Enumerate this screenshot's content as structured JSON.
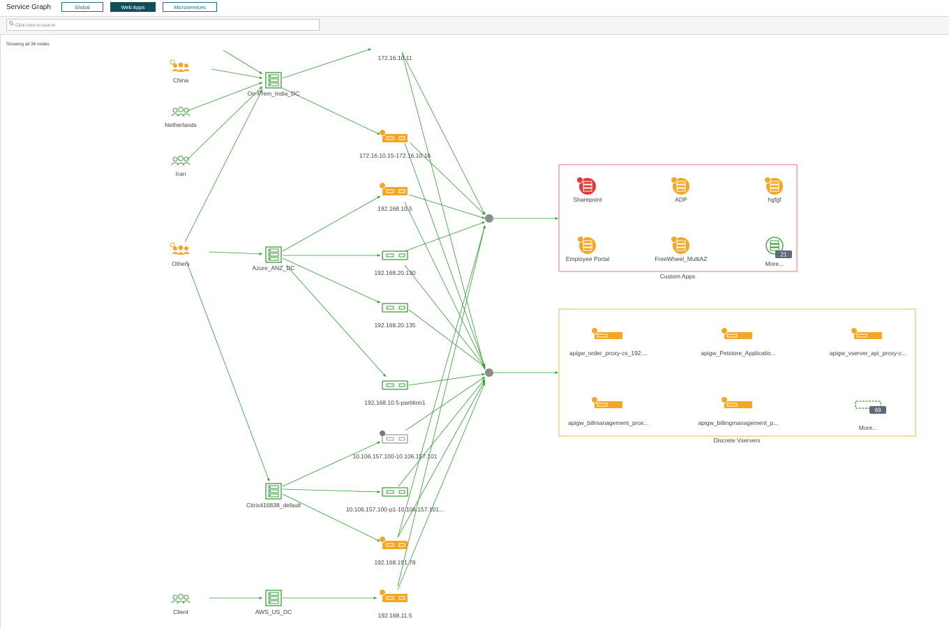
{
  "header": {
    "title": "Service Graph",
    "tabs": [
      {
        "label": "Global",
        "active": false
      },
      {
        "label": "Web Apps",
        "active": true
      },
      {
        "label": "Microservices",
        "active": false
      }
    ]
  },
  "search": {
    "placeholder": "Click here to search"
  },
  "status": {
    "node_count": "Showing all 36 nodes"
  },
  "colors": {
    "edge": "#2e9e2e",
    "orange": "#f5a623",
    "green": "#3a9a3a",
    "gray": "#888888",
    "red": "#e53935",
    "teal": "#0f4f5c"
  },
  "graph": {
    "clients": [
      {
        "label": "China",
        "status": "orange"
      },
      {
        "label": "Netherlands",
        "status": "green"
      },
      {
        "label": "Iran",
        "status": "green"
      },
      {
        "label": "Others",
        "status": "orange"
      },
      {
        "label": "Client",
        "status": "green"
      }
    ],
    "datacenters": [
      {
        "label": "On-Prem_India_DC"
      },
      {
        "label": "Azure_ANZ_DC"
      },
      {
        "label": "Citrix416838_default"
      },
      {
        "label": "AWS_US_DC"
      }
    ],
    "instances": [
      {
        "label": "172.16.10.11",
        "status": "none"
      },
      {
        "label": "172.16.10.15-172.16.10.16",
        "status": "orange"
      },
      {
        "label": "192.168.10.5",
        "status": "orange"
      },
      {
        "label": "192.168.20.130",
        "status": "green"
      },
      {
        "label": "192.168.20.135",
        "status": "green"
      },
      {
        "label": "192.168.10.5-partition1",
        "status": "green"
      },
      {
        "label": "10.106.157.100-10.106.157.101",
        "status": "gray"
      },
      {
        "label": "10.106.157.100-p1-10.106.157.101...",
        "status": "green"
      },
      {
        "label": "192.168.191.78",
        "status": "orange"
      },
      {
        "label": "192.168.11.5",
        "status": "orange"
      }
    ],
    "custom_apps": {
      "title": "Custom Apps",
      "items": [
        {
          "label": "Sharepoint",
          "status": "red",
          "alert": "!"
        },
        {
          "label": "ADP",
          "status": "orange"
        },
        {
          "label": "hgfgf",
          "status": "orange"
        },
        {
          "label": "Employee Portal",
          "status": "orange"
        },
        {
          "label": "FreeWheel_MultiAZ",
          "status": "orange"
        },
        {
          "label": "More...",
          "status": "green",
          "count": "21"
        }
      ]
    },
    "discrete_vservers": {
      "title": "Discrete Vservers",
      "items": [
        {
          "label": "apigw_order_proxy-cs_192....",
          "status": "orange"
        },
        {
          "label": "apigw_Petstore_Applicatio...",
          "status": "orange"
        },
        {
          "label": "apigw_vserver_api_proxy-c...",
          "status": "orange"
        },
        {
          "label": "apigw_billmanagement_prox...",
          "status": "orange"
        },
        {
          "label": "apigw_billingmanagement_p...",
          "status": "orange"
        },
        {
          "label": "More...",
          "status": "green",
          "count": "69"
        }
      ]
    }
  }
}
